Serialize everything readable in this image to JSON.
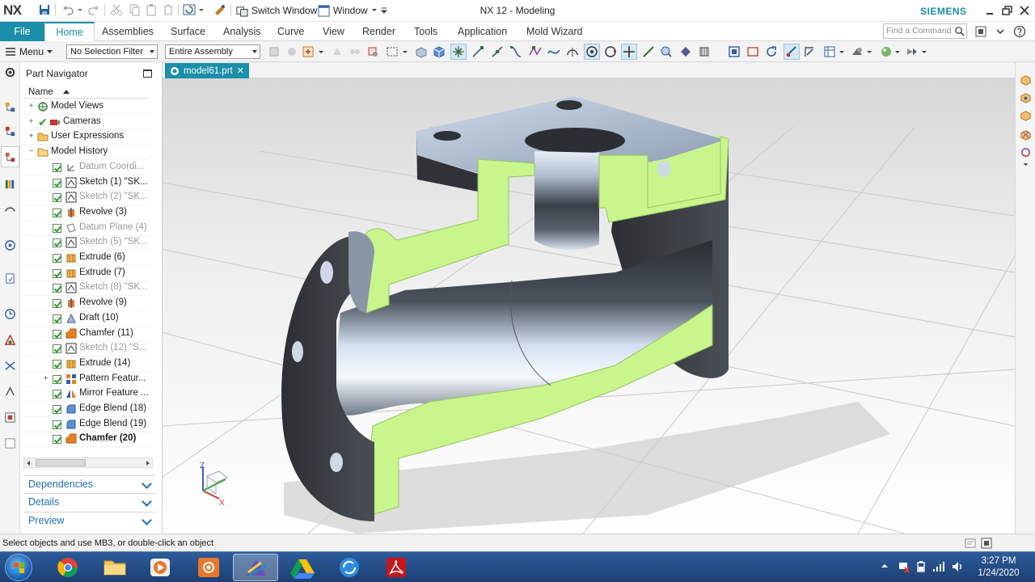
{
  "titlebar": {
    "logo": "NX",
    "switch_window_label": "Switch Window",
    "window_menu_label": "Window",
    "app_title": "NX 12 - Modeling",
    "brand": "SIEMENS"
  },
  "ribbon": {
    "file_label": "File",
    "tabs": [
      "Home",
      "Assemblies",
      "Surface",
      "Analysis",
      "Curve",
      "View",
      "Render",
      "Tools",
      "Application",
      "Mold Wizard"
    ],
    "find_placeholder": "Find a Command"
  },
  "toolbar": {
    "menu_label": "Menu",
    "selection_filter": "No Selection Filter",
    "assembly_scope": "Entire Assembly"
  },
  "navigator": {
    "title": "Part Navigator",
    "column_name": "Name",
    "nodes": [
      {
        "label": "Model Views",
        "type": "views"
      },
      {
        "label": "Cameras",
        "type": "cameras"
      },
      {
        "label": "User Expressions",
        "type": "folder"
      },
      {
        "label": "Model History",
        "type": "folder-open"
      },
      {
        "label": "Datum Coordi...",
        "type": "datum-csys"
      },
      {
        "label": "Sketch (1) \"SK...",
        "type": "sketch"
      },
      {
        "label": "Sketch (2) \"SK...",
        "type": "sketch"
      },
      {
        "label": "Revolve (3)",
        "type": "revolve"
      },
      {
        "label": "Datum Plane (4)",
        "type": "datum-plane"
      },
      {
        "label": "Sketch (5) \"SK...",
        "type": "sketch"
      },
      {
        "label": "Extrude (6)",
        "type": "extrude"
      },
      {
        "label": "Extrude (7)",
        "type": "extrude"
      },
      {
        "label": "Sketch (8) \"SK...",
        "type": "sketch"
      },
      {
        "label": "Revolve (9)",
        "type": "revolve"
      },
      {
        "label": "Draft (10)",
        "type": "draft"
      },
      {
        "label": "Chamfer (11)",
        "type": "chamfer"
      },
      {
        "label": "Sketch (12) \"S...",
        "type": "sketch"
      },
      {
        "label": "Extrude (14)",
        "type": "extrude"
      },
      {
        "label": "Pattern Featur...",
        "type": "pattern"
      },
      {
        "label": "Mirror Feature ...",
        "type": "mirror"
      },
      {
        "label": "Edge Blend (18)",
        "type": "blend"
      },
      {
        "label": "Edge Blend (19)",
        "type": "blend"
      },
      {
        "label": "Chamfer (20)",
        "type": "chamfer"
      }
    ],
    "sections": [
      "Dependencies",
      "Details",
      "Preview"
    ]
  },
  "document": {
    "tab_label": "model61.prt"
  },
  "triad": {
    "z": "Z",
    "x": "X"
  },
  "statusbar": {
    "message": "Select objects and use MB3, or double-click an object"
  },
  "taskbar": {
    "time": "3:27 PM",
    "date": "1/24/2020"
  },
  "colors": {
    "accent": "#1b8ea9",
    "section_face": "#c8f58c",
    "metal_dark": "#3a3d40",
    "metal_light": "#c9d6e6"
  }
}
